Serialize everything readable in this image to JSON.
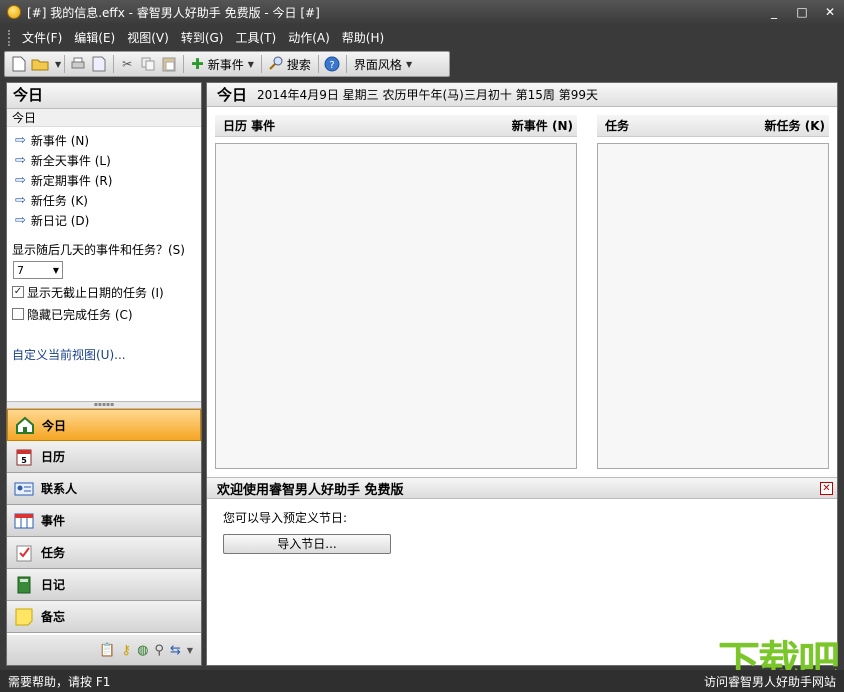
{
  "window": {
    "title": "[#] 我的信息.effx - 睿智男人好助手 免费版 - 今日 [#]",
    "min": "_",
    "max": "□",
    "close": "✕"
  },
  "menu": [
    "文件(F)",
    "编辑(E)",
    "视图(V)",
    "转到(G)",
    "工具(T)",
    "动作(A)",
    "帮助(H)"
  ],
  "toolbar": {
    "new_event": "新事件",
    "search": "搜索",
    "theme": "界面风格"
  },
  "left": {
    "header": "今日",
    "today_label": "今日",
    "links": [
      "新事件 (N)",
      "新全天事件 (L)",
      "新定期事件 (R)",
      "新任务 (K)",
      "新日记 (D)"
    ],
    "days_label": "显示随后几天的事件和任务？(S)",
    "days_value": "7",
    "show_no_due": "显示无截止日期的任务 (I)",
    "show_no_due_checked": "✓",
    "hide_done": "隐藏已完成任务 (C)",
    "customize": "自定义当前视图(U)..."
  },
  "nav": [
    "今日",
    "日历",
    "联系人",
    "事件",
    "任务",
    "日记",
    "备忘"
  ],
  "main": {
    "title": "今日",
    "date": "2014年4月9日 星期三 农历甲午年(马)三月初十 第15周 第99天",
    "cal_col": "日历 事件",
    "new_event": "新事件 (N)",
    "task_col": "任务",
    "new_task": "新任务 (K)",
    "welcome": "欢迎使用睿智男人好助手 免费版",
    "import_hint": "您可以导入预定义节日:",
    "import_btn": "导入节日..."
  },
  "status": {
    "left": "需要帮助，请按 F1",
    "right": "访问睿智男人好助手网站"
  },
  "watermark": "下载吧"
}
